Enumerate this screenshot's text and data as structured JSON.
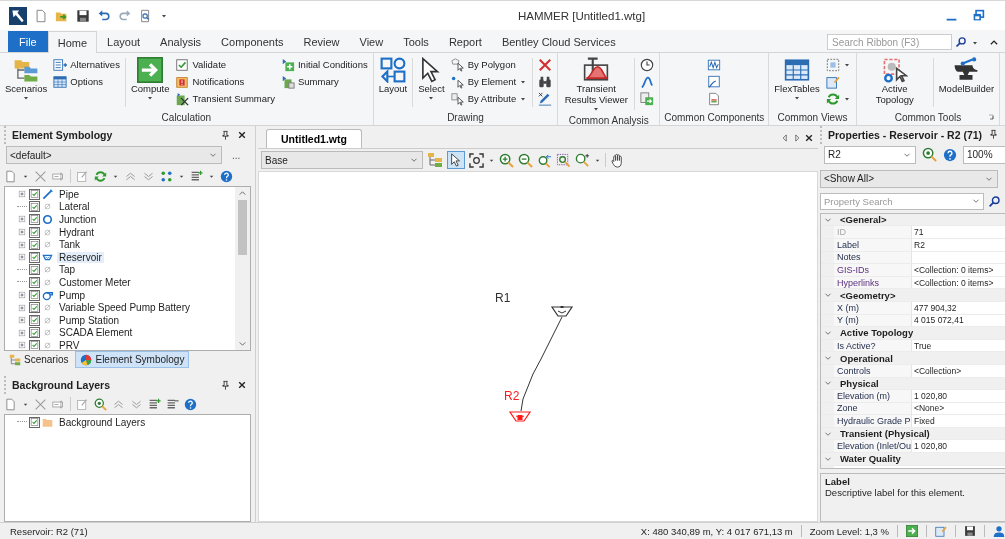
{
  "title_bar": {
    "title": "HAMMER [Untitled1.wtg]"
  },
  "ribbon_tabs": [
    {
      "label": "File",
      "selected": false,
      "kind": "file"
    },
    {
      "label": "Home",
      "selected": true,
      "kind": "tab"
    },
    {
      "label": "Layout",
      "selected": false,
      "kind": "tab"
    },
    {
      "label": "Analysis",
      "selected": false,
      "kind": "tab"
    },
    {
      "label": "Components",
      "selected": false,
      "kind": "tab"
    },
    {
      "label": "Review",
      "selected": false,
      "kind": "tab"
    },
    {
      "label": "View",
      "selected": false,
      "kind": "tab"
    },
    {
      "label": "Tools",
      "selected": false,
      "kind": "tab"
    },
    {
      "label": "Report",
      "selected": false,
      "kind": "tab"
    },
    {
      "label": "Bentley Cloud Services",
      "selected": false,
      "kind": "tab"
    }
  ],
  "ribbon_search": {
    "placeholder": "Search Ribbon (F3)"
  },
  "ribbon_groups": [
    {
      "label": "Calculation",
      "dialog_launcher": false,
      "columns": [
        {
          "kind": "large",
          "items": [
            {
              "label": "Scenarios",
              "dropdown": true
            }
          ]
        },
        {
          "kind": "small",
          "items": [
            {
              "label": "Alternatives",
              "dropdown": false
            },
            {
              "label": "Options",
              "dropdown": false
            }
          ]
        },
        {
          "kind": "separator"
        },
        {
          "kind": "large",
          "items": [
            {
              "label": "Compute",
              "dropdown": true
            }
          ]
        },
        {
          "kind": "small",
          "items": [
            {
              "label": "Validate",
              "dropdown": false
            },
            {
              "label": "Notifications",
              "dropdown": false
            },
            {
              "label": "Transient Summary",
              "dropdown": false
            }
          ]
        },
        {
          "kind": "small",
          "items": [
            {
              "label": "Initial Conditions",
              "dropdown": false
            },
            {
              "label": "Summary",
              "dropdown": false
            }
          ]
        }
      ]
    },
    {
      "label": "Drawing",
      "dialog_launcher": false,
      "columns": [
        {
          "kind": "large",
          "items": [
            {
              "label": "Layout",
              "dropdown": false
            }
          ]
        },
        {
          "kind": "separator"
        },
        {
          "kind": "large",
          "items": [
            {
              "label": "Select",
              "dropdown": true
            }
          ]
        },
        {
          "kind": "small",
          "items": [
            {
              "label": "By Polygon",
              "dropdown": false
            },
            {
              "label": "By Element",
              "dropdown": true
            },
            {
              "label": "By Attribute",
              "dropdown": true
            }
          ]
        },
        {
          "kind": "separator"
        },
        {
          "kind": "small",
          "items": [
            {
              "dropdown": false
            },
            {
              "dropdown": false
            },
            {
              "dropdown": false
            }
          ]
        }
      ]
    },
    {
      "label": "Common Analysis",
      "dialog_launcher": false,
      "columns": [
        {
          "kind": "large",
          "items": [
            {
              "label": "Transient Results Viewer",
              "dropdown": true
            }
          ]
        },
        {
          "kind": "separator"
        },
        {
          "kind": "small",
          "items": [
            {
              "dropdown": false
            },
            {
              "dropdown": false
            },
            {
              "dropdown": false
            }
          ]
        }
      ]
    },
    {
      "label": "Common Components",
      "dialog_launcher": false,
      "columns": [
        {
          "kind": "small",
          "items": [
            {
              "dropdown": false
            },
            {
              "dropdown": false
            },
            {
              "dropdown": false
            }
          ]
        }
      ]
    },
    {
      "label": "Common Views",
      "dialog_launcher": false,
      "columns": [
        {
          "kind": "large",
          "items": [
            {
              "label": "FlexTables",
              "dropdown": true
            }
          ]
        },
        {
          "kind": "small",
          "items": [
            {
              "dropdown": true
            },
            {
              "dropdown": false
            },
            {
              "dropdown": true
            }
          ]
        }
      ]
    },
    {
      "label": "Common Tools",
      "dialog_launcher": true,
      "columns": [
        {
          "kind": "large",
          "items": [
            {
              "label": "Active Topology",
              "dropdown": false
            }
          ]
        },
        {
          "kind": "separator"
        },
        {
          "kind": "large",
          "items": [
            {
              "label": "ModelBuilder",
              "dropdown": false
            }
          ]
        }
      ]
    }
  ],
  "element_symbology": {
    "title": "Element Symbology",
    "profile": "<default>",
    "more_button": "...",
    "items": [
      {
        "label": "Pipe",
        "kind": "group",
        "checked": true,
        "selected": false
      },
      {
        "label": "Lateral",
        "kind": "leaf",
        "checked": true,
        "selected": false
      },
      {
        "label": "Junction",
        "kind": "group",
        "checked": true,
        "selected": false
      },
      {
        "label": "Hydrant",
        "kind": "group",
        "checked": true,
        "selected": false
      },
      {
        "label": "Tank",
        "kind": "group",
        "checked": true,
        "selected": false
      },
      {
        "label": "Reservoir",
        "kind": "group",
        "checked": true,
        "selected": true
      },
      {
        "label": "Tap",
        "kind": "leaf",
        "checked": true,
        "selected": false
      },
      {
        "label": "Customer Meter",
        "kind": "leaf",
        "checked": true,
        "selected": false
      },
      {
        "label": "Pump",
        "kind": "group",
        "checked": true,
        "selected": false
      },
      {
        "label": "Variable Speed Pump Battery",
        "kind": "group",
        "checked": true,
        "selected": false
      },
      {
        "label": "Pump Station",
        "kind": "group",
        "checked": true,
        "selected": false
      },
      {
        "label": "SCADA Element",
        "kind": "group",
        "checked": true,
        "selected": false
      },
      {
        "label": "PRV",
        "kind": "group",
        "checked": true,
        "selected": false
      }
    ],
    "tabs": [
      {
        "label": "Scenarios",
        "selected": false
      },
      {
        "label": "Element Symbology",
        "selected": true
      }
    ]
  },
  "background_layers": {
    "title": "Background Layers",
    "items": [
      {
        "label": "Background Layers",
        "checked": true
      }
    ]
  },
  "document": {
    "tab": {
      "label": "Untitled1.wtg",
      "selected": true
    },
    "scenario": "Base",
    "elements": [
      {
        "label": "R1",
        "selected": false
      },
      {
        "label": "R2",
        "selected": true
      }
    ]
  },
  "properties": {
    "title": "Properties - Reservoir - R2 (71)",
    "element": "R2",
    "zoom": "100%",
    "filter": "<Show All>",
    "search": {
      "placeholder": "Property Search"
    },
    "categories": [
      {
        "label": "<General>",
        "expanded": true,
        "rows": [
          {
            "name": "ID",
            "value": "71",
            "disabled": true,
            "kind": "text"
          },
          {
            "name": "Label",
            "value": "R2",
            "disabled": false,
            "kind": "text"
          },
          {
            "name": "Notes",
            "disabled": false,
            "kind": "text"
          },
          {
            "name": "GIS-IDs",
            "value": "<Collection: 0 items>",
            "disabled": false,
            "kind": "link"
          },
          {
            "name": "Hyperlinks",
            "value": "<Collection: 0 items>",
            "disabled": false,
            "kind": "link"
          }
        ]
      },
      {
        "label": "<Geometry>",
        "expanded": true,
        "rows": [
          {
            "name": "X (m)",
            "value": "477 904,32",
            "disabled": false,
            "kind": "text"
          },
          {
            "name": "Y (m)",
            "value": "4 015 072,41",
            "disabled": false,
            "kind": "text"
          }
        ]
      },
      {
        "label": "Active Topology",
        "expanded": true,
        "rows": [
          {
            "name": "Is Active?",
            "value": "True",
            "disabled": false,
            "kind": "text"
          }
        ]
      },
      {
        "label": "Operational",
        "expanded": true,
        "rows": [
          {
            "name": "Controls",
            "value": "<Collection>",
            "disabled": false,
            "kind": "text"
          }
        ]
      },
      {
        "label": "Physical",
        "expanded": true,
        "rows": [
          {
            "name": "Elevation (m)",
            "value": "1 020,80",
            "disabled": false,
            "kind": "text"
          },
          {
            "name": "Zone",
            "value": "<None>",
            "disabled": false,
            "kind": "text"
          },
          {
            "name": "Hydraulic Grade P",
            "value": "Fixed",
            "disabled": false,
            "kind": "text"
          }
        ]
      },
      {
        "label": "Transient (Physical)",
        "expanded": true,
        "rows": [
          {
            "name": "Elevation (Inlet/Ou",
            "value": "1 020,80",
            "disabled": false,
            "kind": "text"
          }
        ]
      },
      {
        "label": "Water Quality",
        "expanded": true
      }
    ],
    "description": {
      "title": "Label",
      "text": "Descriptive label for this element."
    }
  },
  "status_bar": {
    "selection": "Reservoir: R2 (71)",
    "coordinates": "X: 480 340,89 m, Y: 4 017 671,13 m",
    "zoom": "Zoom Level: 1,3 %"
  }
}
